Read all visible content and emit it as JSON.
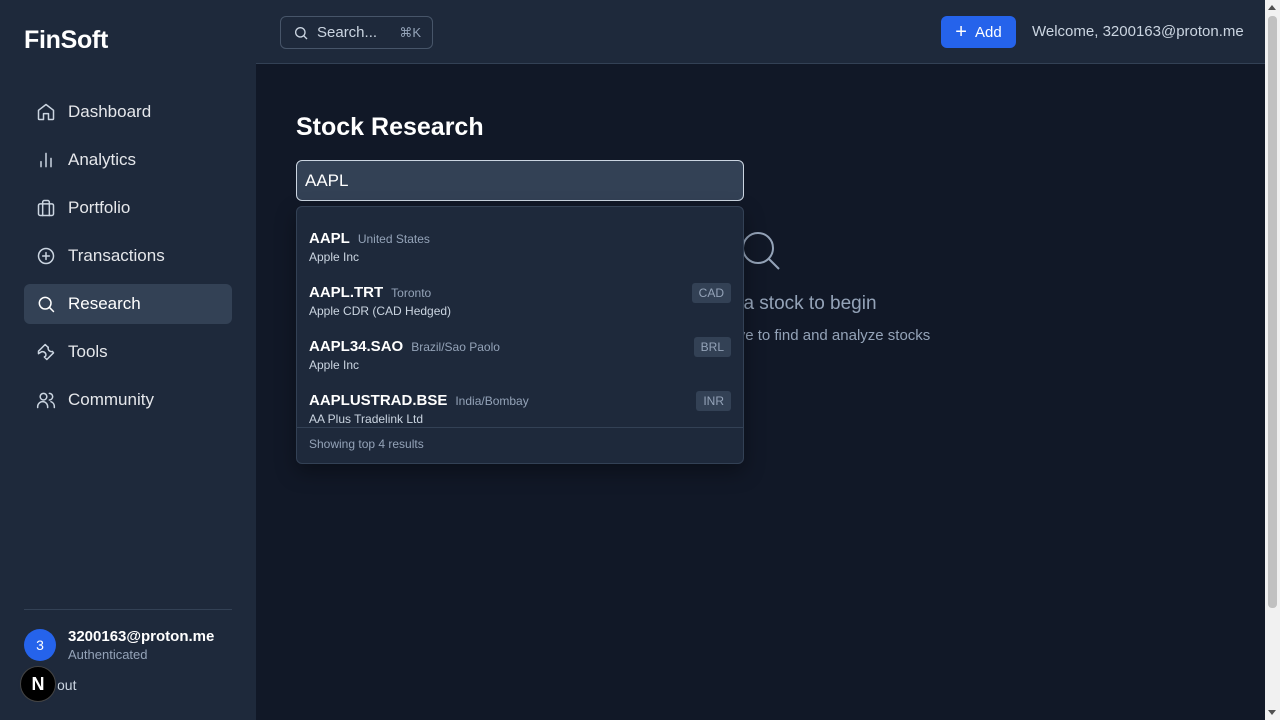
{
  "brand": "FinSoft",
  "sidebar": {
    "items": [
      {
        "label": "Dashboard",
        "icon": "home-icon",
        "active": false
      },
      {
        "label": "Analytics",
        "icon": "bar-chart-icon",
        "active": false
      },
      {
        "label": "Portfolio",
        "icon": "briefcase-icon",
        "active": false
      },
      {
        "label": "Transactions",
        "icon": "plus-circle-icon",
        "active": false
      },
      {
        "label": "Research",
        "icon": "search-icon",
        "active": true
      },
      {
        "label": "Tools",
        "icon": "wrench-icon",
        "active": false
      },
      {
        "label": "Community",
        "icon": "users-icon",
        "active": false
      }
    ],
    "user": {
      "initial": "3",
      "email": "3200163@proton.me",
      "status": "Authenticated"
    },
    "logout_label": "out",
    "next_badge": "N"
  },
  "header": {
    "search_placeholder": "Search...",
    "search_shortcut": "⌘K",
    "add_label": "Add",
    "welcome": "Welcome, 3200163@proton.me"
  },
  "main": {
    "title": "Stock Research",
    "search_value": "AAPL",
    "empty_title": "a stock to begin",
    "empty_subtitle": "ve to find and analyze stocks"
  },
  "dropdown": {
    "results": [
      {
        "symbol": "AAPL",
        "exchange": "United States",
        "name": "Apple Inc",
        "currency": ""
      },
      {
        "symbol": "AAPL.TRT",
        "exchange": "Toronto",
        "name": "Apple CDR (CAD Hedged)",
        "currency": "CAD"
      },
      {
        "symbol": "AAPL34.SAO",
        "exchange": "Brazil/Sao Paolo",
        "name": "Apple Inc",
        "currency": "BRL"
      },
      {
        "symbol": "AAPLUSTRAD.BSE",
        "exchange": "India/Bombay",
        "name": "AA Plus Tradelink Ltd",
        "currency": "INR"
      }
    ],
    "footer": "Showing top 4 results"
  },
  "colors": {
    "background": "#111827",
    "sidebar": "#1e293b",
    "accent": "#2563eb",
    "active_item": "#334155"
  }
}
